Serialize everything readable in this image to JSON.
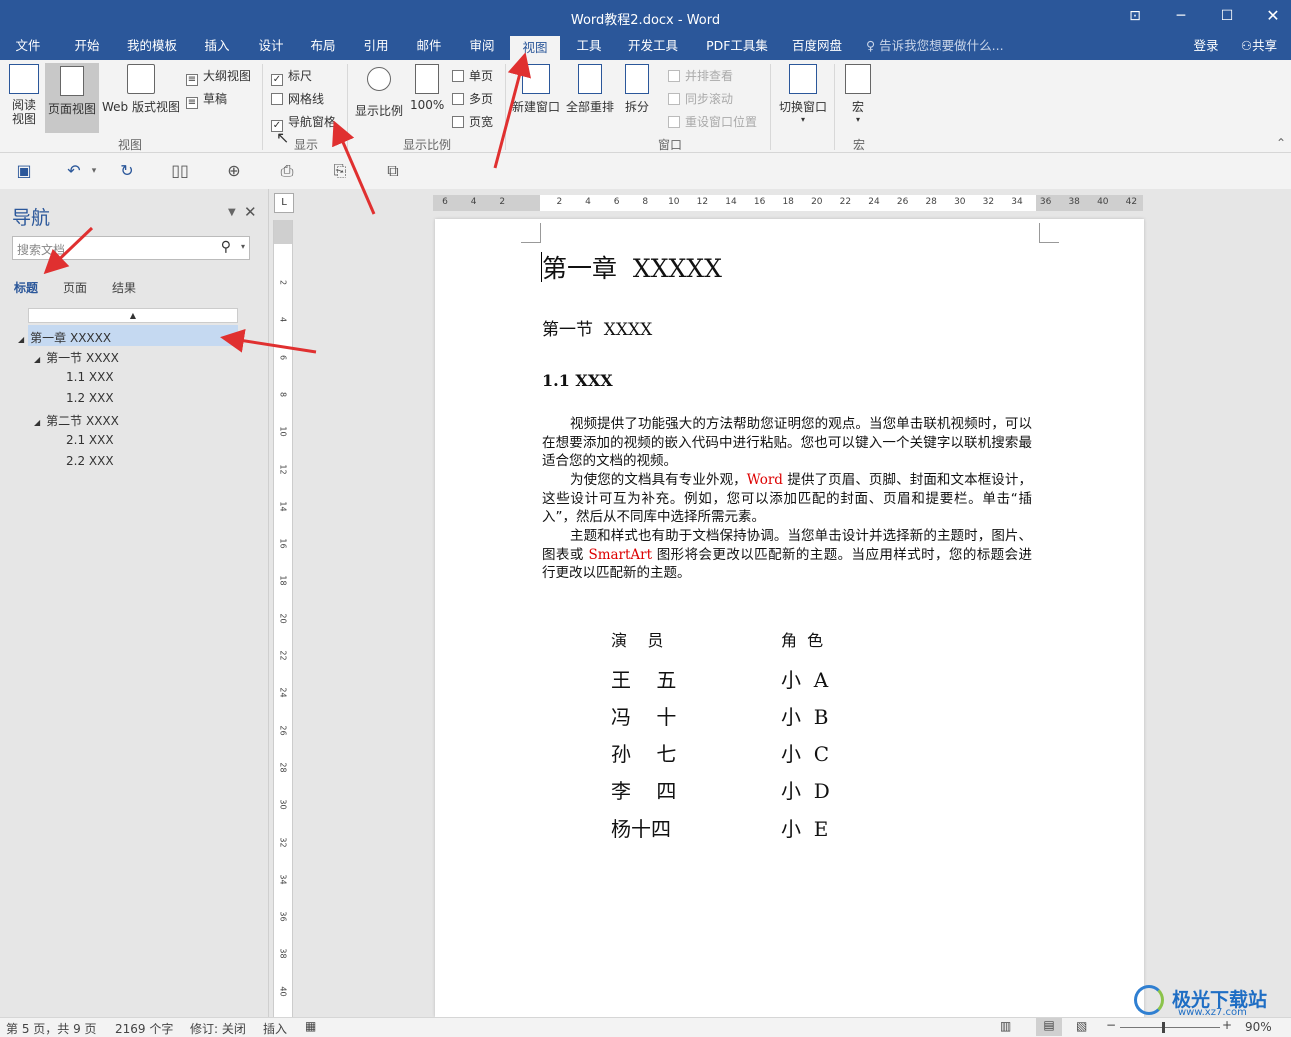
{
  "window": {
    "title": "Word教程2.docx - Word",
    "restore_icon": "ribbon-display-icon",
    "min": "minimize-icon",
    "max": "maximize-icon",
    "close": "close-icon"
  },
  "tabs": [
    "文件",
    "开始",
    "我的模板",
    "插入",
    "设计",
    "布局",
    "引用",
    "邮件",
    "审阅",
    "视图",
    "工具",
    "开发工具",
    "PDF工具集",
    "百度网盘"
  ],
  "active_tab": "视图",
  "tell_me": "告诉我您想要做什么...",
  "login": "登录",
  "share": "共享",
  "ribbon": {
    "views": {
      "read": "阅读\n视图",
      "print": "页面视图",
      "web": "Web 版式视图",
      "outline": "大纲视图",
      "draft": "草稿",
      "group": "视图"
    },
    "show": {
      "ruler": "标尺",
      "gridlines": "网格线",
      "nav_pane": "导航窗格",
      "group": "显示"
    },
    "zoom": {
      "zoom": "显示比例",
      "hundred": "100%",
      "one_page": "单页",
      "multi_page": "多页",
      "page_width": "页宽",
      "group": "显示比例"
    },
    "window": {
      "new_window": "新建窗口",
      "arrange_all": "全部重排",
      "split": "拆分",
      "side_by_side": "并排查看",
      "sync_scroll": "同步滚动",
      "reset_pos": "重设窗口位置",
      "switch": "切换窗口",
      "group": "窗口"
    },
    "macros": {
      "macro": "宏",
      "group": "宏"
    }
  },
  "nav": {
    "title": "导航",
    "search_placeholder": "搜索文档",
    "tabs": [
      "标题",
      "页面",
      "结果"
    ],
    "tree": [
      {
        "label": "第一章 XXXXX",
        "level": 0,
        "selected": true
      },
      {
        "label": "第一节 XXXX",
        "level": 1
      },
      {
        "label": "1.1 XXX",
        "level": 2
      },
      {
        "label": "1.2 XXX",
        "level": 2
      },
      {
        "label": "第二节 XXXX",
        "level": 1
      },
      {
        "label": "2.1 XXX",
        "level": 2
      },
      {
        "label": "2.2 XXX",
        "level": 2
      }
    ]
  },
  "ruler": {
    "h_ticks": [
      "6",
      "4",
      "2",
      "",
      "2",
      "4",
      "6",
      "8",
      "10",
      "12",
      "14",
      "16",
      "18",
      "20",
      "22",
      "24",
      "26",
      "28",
      "30",
      "32",
      "34",
      "36",
      "38",
      "40",
      "42"
    ],
    "v_ticks": [
      "2",
      "4",
      "6",
      "8",
      "10",
      "12",
      "14",
      "16",
      "18",
      "20",
      "22",
      "24",
      "26",
      "28",
      "30",
      "32",
      "34",
      "36",
      "38",
      "40"
    ],
    "tab_stop": "L"
  },
  "doc": {
    "h1": "第一章  XXXXX",
    "h2": "第一节  XXXX",
    "h3": "1.1 XXX",
    "p1": "视频提供了功能强大的方法帮助您证明您的观点。当您单击联机视频时，可以在想要添加的视频的嵌入代码中进行粘贴。您也可以键入一个关键字以联机搜索最适合您的文档的视频。",
    "p2_a": "为使您的文档具有专业外观，",
    "p2_word": "Word",
    "p2_b": " 提供了页眉、页脚、封面和文本框设计，这些设计可互为补充。例如，您可以添加匹配的封面、页眉和提要栏。单击“插入”，然后从不同库中选择所需元素。",
    "p3_a": "主题和样式也有助于文档保持协调。当您单击设计并选择新的主题时，图片、图表或 ",
    "p3_smartart": "SmartArt",
    "p3_b": " 图形将会更改以匹配新的主题。当应用样式时，您的标题会进行更改以匹配新的主题。",
    "table_header": [
      "演    员",
      "角  色"
    ],
    "table_rows": [
      [
        "王    五",
        "小  A"
      ],
      [
        "冯    十",
        "小  B"
      ],
      [
        "孙    七",
        "小  C"
      ],
      [
        "李    四",
        "小  D"
      ],
      [
        "杨十四",
        "小  E"
      ]
    ]
  },
  "status": {
    "page": "第 5 页，共 9 页",
    "words": "2169 个字",
    "track": "修订: 关闭",
    "insert": "插入",
    "zoom": "90%"
  },
  "watermark": {
    "text": "极光下载站",
    "url": "www.xz7.com"
  },
  "colors": {
    "accent": "#2b579a",
    "annotation": "#e03030",
    "highlight": "#c5d9f1"
  }
}
